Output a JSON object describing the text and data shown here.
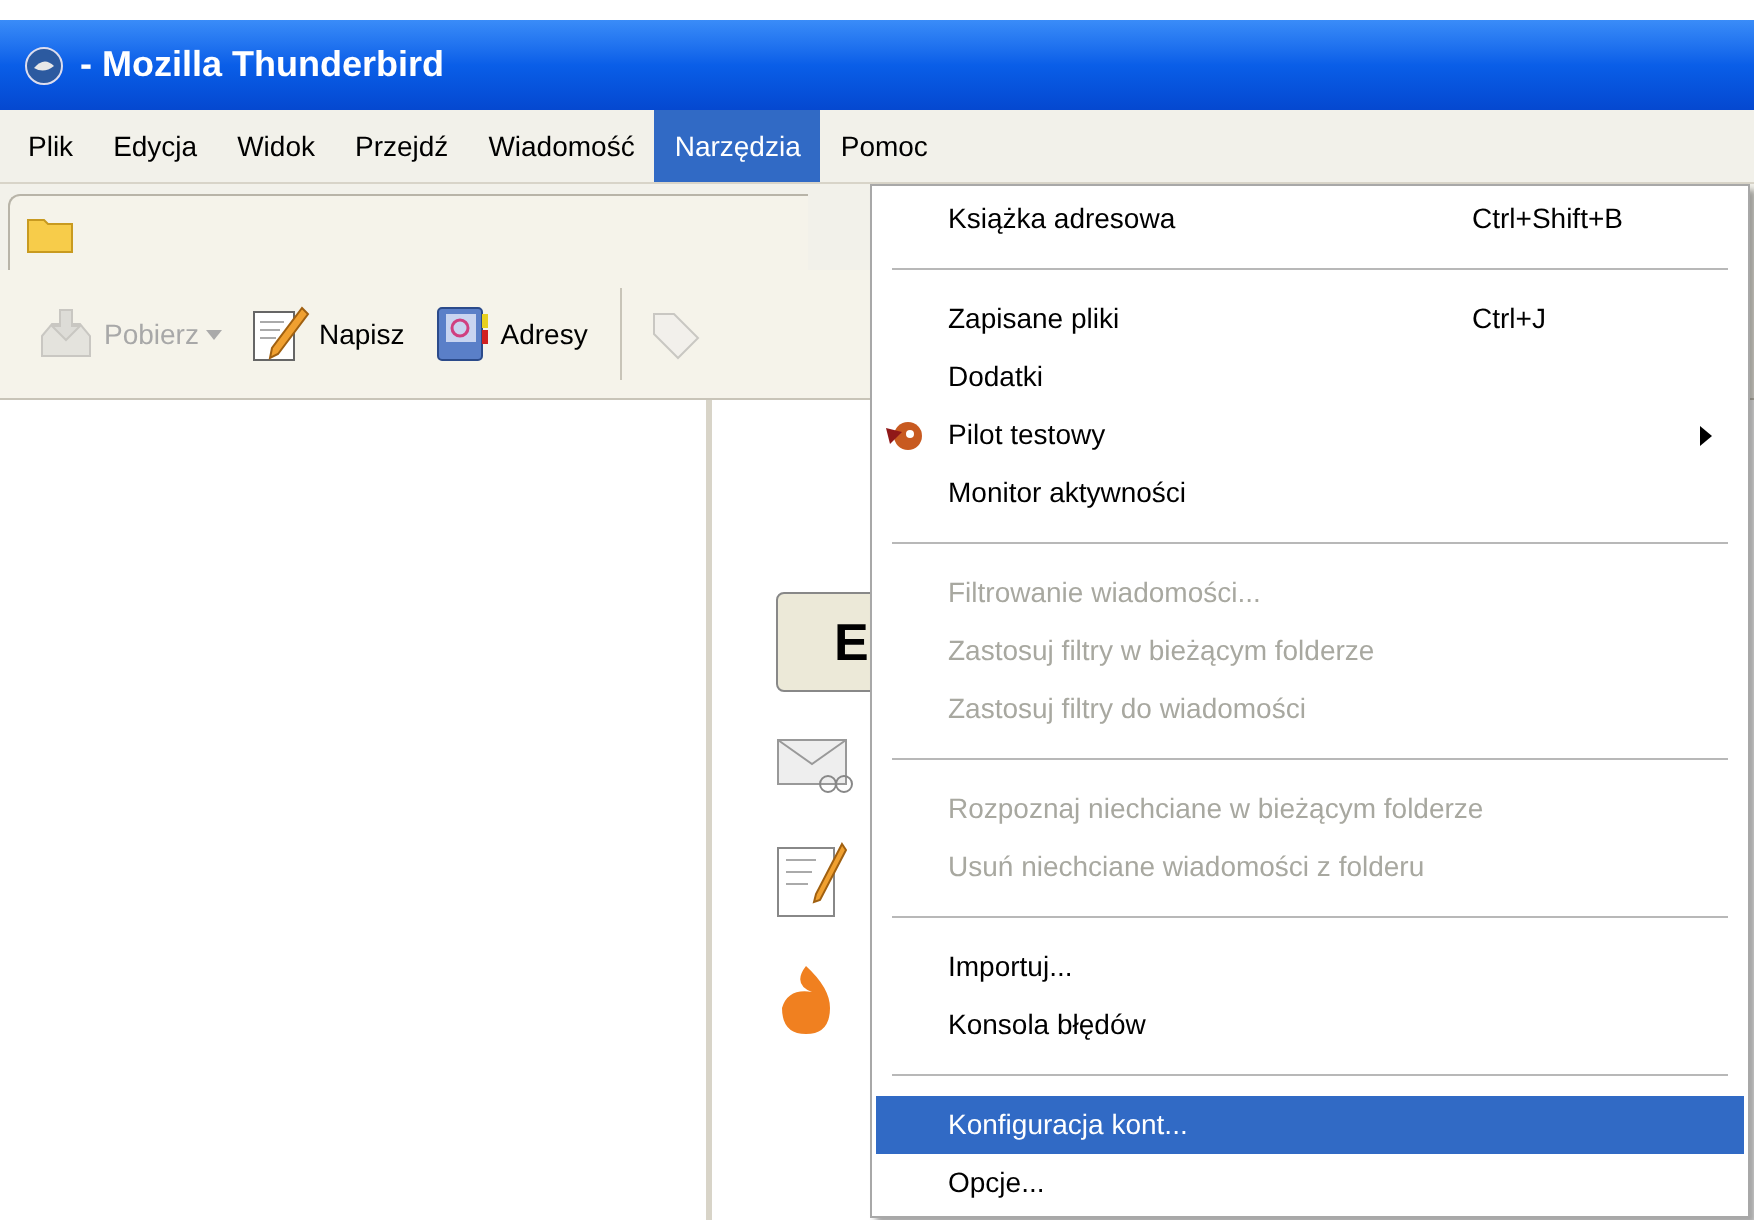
{
  "window": {
    "title": "- Mozilla Thunderbird"
  },
  "menubar": [
    {
      "label": "Plik",
      "selected": false
    },
    {
      "label": "Edycja",
      "selected": false
    },
    {
      "label": "Widok",
      "selected": false
    },
    {
      "label": "Przejdź",
      "selected": false
    },
    {
      "label": "Wiadomość",
      "selected": false
    },
    {
      "label": "Narzędzia",
      "selected": true
    },
    {
      "label": "Pomoc",
      "selected": false
    }
  ],
  "toolbar": [
    {
      "kind": "get",
      "label": "Pobierz",
      "disabled": true,
      "dropdown": true
    },
    {
      "kind": "write",
      "label": "Napisz",
      "disabled": false,
      "dropdown": false
    },
    {
      "kind": "addressbook",
      "label": "Adresy",
      "disabled": false,
      "dropdown": false
    }
  ],
  "content": {
    "button": "E"
  },
  "menu": [
    {
      "kind": "item",
      "label": "Książka adresowa",
      "shortcut": "Ctrl+Shift+B",
      "disabled": false,
      "selected": false,
      "submenu": false,
      "icon": false
    },
    {
      "kind": "separator"
    },
    {
      "kind": "item",
      "label": "Zapisane pliki",
      "shortcut": "Ctrl+J",
      "disabled": false,
      "selected": false,
      "submenu": false,
      "icon": false
    },
    {
      "kind": "item",
      "label": "Dodatki",
      "disabled": false,
      "selected": false,
      "submenu": false,
      "icon": false
    },
    {
      "kind": "item",
      "label": "Pilot testowy",
      "disabled": false,
      "selected": false,
      "submenu": true,
      "icon": true
    },
    {
      "kind": "item",
      "label": "Monitor aktywności",
      "disabled": false,
      "selected": false,
      "submenu": false,
      "icon": false
    },
    {
      "kind": "separator"
    },
    {
      "kind": "item",
      "label": "Filtrowanie wiadomości...",
      "disabled": true,
      "selected": false,
      "submenu": false,
      "icon": false
    },
    {
      "kind": "item",
      "label": "Zastosuj filtry w bieżącym folderze",
      "disabled": true,
      "selected": false,
      "submenu": false,
      "icon": false
    },
    {
      "kind": "item",
      "label": "Zastosuj filtry do wiadomości",
      "disabled": true,
      "selected": false,
      "submenu": false,
      "icon": false
    },
    {
      "kind": "separator"
    },
    {
      "kind": "item",
      "label": "Rozpoznaj niechciane w bieżącym folderze",
      "disabled": true,
      "selected": false,
      "submenu": false,
      "icon": false
    },
    {
      "kind": "item",
      "label": "Usuń niechciane wiadomości z folderu",
      "disabled": true,
      "selected": false,
      "submenu": false,
      "icon": false
    },
    {
      "kind": "separator"
    },
    {
      "kind": "item",
      "label": "Importuj...",
      "disabled": false,
      "selected": false,
      "submenu": false,
      "icon": false
    },
    {
      "kind": "item",
      "label": "Konsola błędów",
      "disabled": false,
      "selected": false,
      "submenu": false,
      "icon": false
    },
    {
      "kind": "separator"
    },
    {
      "kind": "item",
      "label": "Konfiguracja kont...",
      "disabled": false,
      "selected": true,
      "submenu": false,
      "icon": false
    },
    {
      "kind": "item",
      "label": "Opcje...",
      "disabled": false,
      "selected": false,
      "submenu": false,
      "icon": false
    }
  ]
}
